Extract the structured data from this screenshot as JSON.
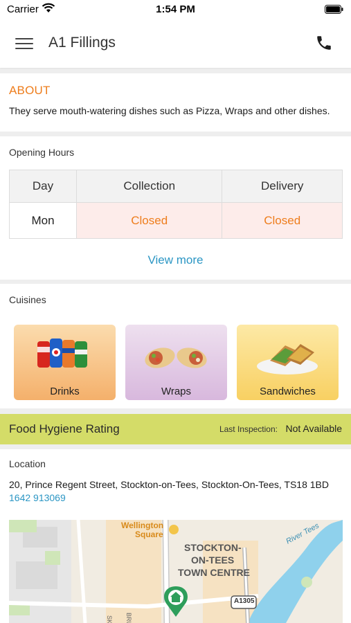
{
  "status_bar": {
    "carrier": "Carrier",
    "time": "1:54 PM"
  },
  "header": {
    "title": "A1 Fillings"
  },
  "about": {
    "title": "ABOUT",
    "text": "They serve mouth-watering dishes such as Pizza, Wraps  and other dishes."
  },
  "opening_hours": {
    "label": "Opening Hours",
    "columns": [
      "Day",
      "Collection",
      "Delivery"
    ],
    "rows": [
      {
        "day": "Mon",
        "collection": "Closed",
        "delivery": "Closed"
      }
    ],
    "view_more": "View more"
  },
  "cuisines": {
    "label": "Cuisines",
    "items": [
      {
        "label": "Drinks",
        "icon": "drinks-cans-image"
      },
      {
        "label": "Wraps",
        "icon": "wraps-image"
      },
      {
        "label": "Sandwiches",
        "icon": "sandwiches-image"
      }
    ]
  },
  "hygiene": {
    "title": "Food Hygiene Rating",
    "last_inspection_label": "Last Inspection:",
    "last_inspection_value": "Not Available"
  },
  "location": {
    "label": "Location",
    "address": "20, Prince Regent Street, Stockton-on-Tees, Stockton-On-Tees, TS18 1BD",
    "phone": "1642 913069",
    "map": {
      "labels": [
        "Wellington",
        "Square",
        "STOCKTON-",
        "ON-TEES",
        "TOWN CENTRE",
        "River Tees",
        "A1305",
        "BRUNSWI",
        "SKINN"
      ]
    }
  },
  "colors": {
    "accent_orange": "#ee7d1c",
    "link_blue": "#2b96c4",
    "hygiene_bar": "#d4dc68",
    "closed_cell": "#fdecea",
    "map_pin": "#2e9e5b"
  }
}
